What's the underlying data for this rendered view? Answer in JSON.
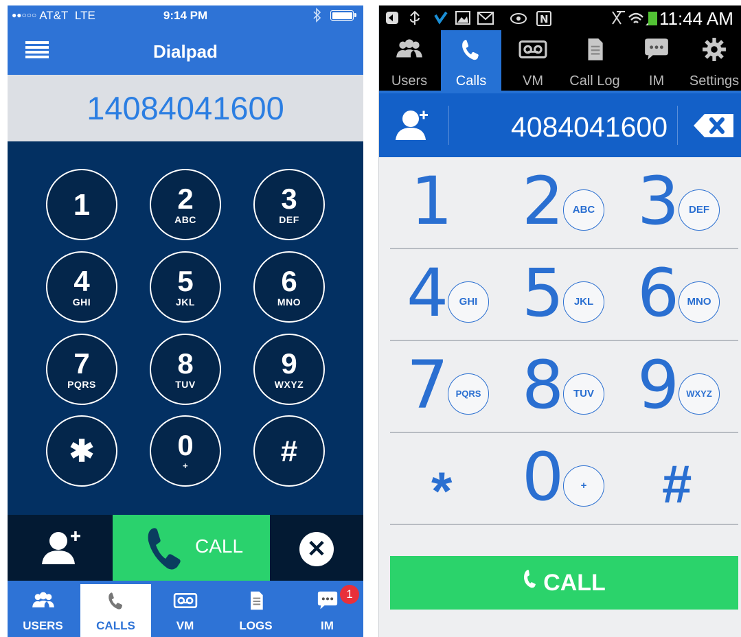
{
  "ios": {
    "status": {
      "dots": "●●○○○",
      "carrier": "AT&T",
      "network": "LTE",
      "time": "9:14 PM",
      "bluetooth": "✱"
    },
    "nav": {
      "title": "Dialpad",
      "menu_icon": "list-icon"
    },
    "display": {
      "number": "14084041600"
    },
    "keys": [
      {
        "digit": "1",
        "letters": ""
      },
      {
        "digit": "2",
        "letters": "ABC"
      },
      {
        "digit": "3",
        "letters": "DEF"
      },
      {
        "digit": "4",
        "letters": "GHI"
      },
      {
        "digit": "5",
        "letters": "JKL"
      },
      {
        "digit": "6",
        "letters": "MNO"
      },
      {
        "digit": "7",
        "letters": "PQRS"
      },
      {
        "digit": "8",
        "letters": "TUV"
      },
      {
        "digit": "9",
        "letters": "WXYZ"
      },
      {
        "digit": "✱",
        "letters": ""
      },
      {
        "digit": "0",
        "letters": "+"
      },
      {
        "digit": "#",
        "letters": ""
      }
    ],
    "actions": {
      "call_label": "CALL",
      "clear_symbol": "✕"
    },
    "tabs": [
      {
        "label": "USERS",
        "icon": "users-icon",
        "active": false
      },
      {
        "label": "CALLS",
        "icon": "phone-icon",
        "active": true
      },
      {
        "label": "VM",
        "icon": "voicemail-icon",
        "active": false
      },
      {
        "label": "LOGS",
        "icon": "document-icon",
        "active": false
      },
      {
        "label": "IM",
        "icon": "chat-icon",
        "active": false
      }
    ],
    "im_badge": "1",
    "colors": {
      "primary": "#2e73d6",
      "pad_bg": "#033062",
      "call_green": "#2ad26d"
    }
  },
  "android": {
    "status": {
      "time": "11:44 AM",
      "left_icons": "⊕ ψ ✔ ▣ M",
      "right_icons": "◎ N ✕ ◠ ◢"
    },
    "tabs": [
      {
        "label": "Users",
        "icon": "users-icon",
        "active": false
      },
      {
        "label": "Calls",
        "icon": "phone-icon",
        "active": true
      },
      {
        "label": "VM",
        "icon": "voicemail-icon",
        "active": false
      },
      {
        "label": "Call Log",
        "icon": "document-icon",
        "active": false
      },
      {
        "label": "IM",
        "icon": "chat-icon",
        "active": false
      },
      {
        "label": "Settings",
        "icon": "gear-icon",
        "active": false
      }
    ],
    "input": {
      "number": "4084041600"
    },
    "keys": [
      {
        "digit": "1",
        "letters": ""
      },
      {
        "digit": "2",
        "letters": "ABC"
      },
      {
        "digit": "3",
        "letters": "DEF"
      },
      {
        "digit": "4",
        "letters": "GHI"
      },
      {
        "digit": "5",
        "letters": "JKL"
      },
      {
        "digit": "6",
        "letters": "MNO"
      },
      {
        "digit": "7",
        "letters": "PQRS"
      },
      {
        "digit": "8",
        "letters": "TUV"
      },
      {
        "digit": "9",
        "letters": "WXYZ"
      },
      {
        "digit": "*",
        "letters": ""
      },
      {
        "digit": "0",
        "letters": "+"
      },
      {
        "digit": "#",
        "letters": ""
      }
    ],
    "call_label": "CALL",
    "colors": {
      "primary": "#1360c8",
      "digit_blue": "#2a6fd1",
      "call_green": "#2bd36b"
    }
  }
}
